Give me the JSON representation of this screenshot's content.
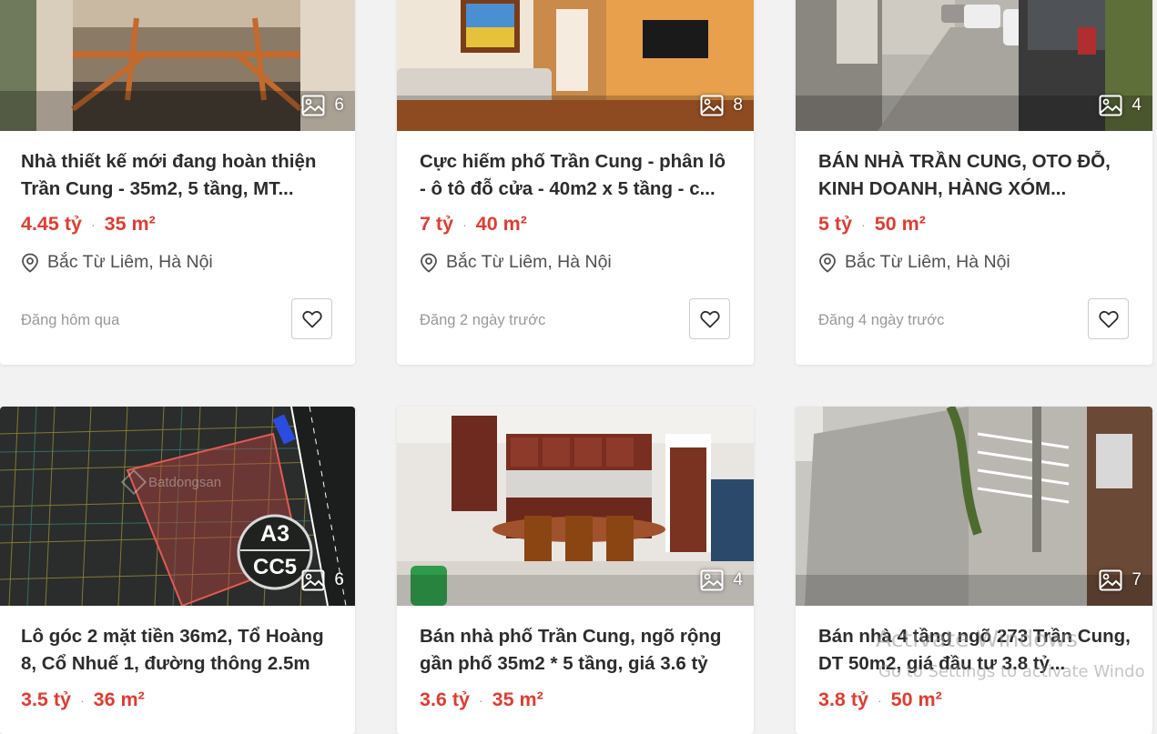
{
  "listings": [
    {
      "title": "Nhà thiết kế mới đang hoàn thiện Trần Cung - 35m2, 5 tầng, MT...",
      "price": "4.45 tỷ",
      "area": "35 m²",
      "location": "Bắc Từ Liêm, Hà Nội",
      "posted": "Đăng hôm qua",
      "photo_count": "6"
    },
    {
      "title": "Cực hiếm phố Trần Cung - phân lô - ô tô đỗ cửa - 40m2 x 5 tầng - c...",
      "price": "7 tỷ",
      "area": "40 m²",
      "location": "Bắc Từ Liêm, Hà Nội",
      "posted": "Đăng 2 ngày trước",
      "photo_count": "8"
    },
    {
      "title": "BÁN NHÀ TRẦN CUNG, OTO ĐỖ, KINH DOANH, HÀNG XÓM...",
      "price": "5 tỷ",
      "area": "50 m²",
      "location": "Bắc Từ Liêm, Hà Nội",
      "posted": "Đăng 4 ngày trước",
      "photo_count": "4"
    },
    {
      "title": "Lô góc 2 mặt tiền 36m2, Tổ Hoàng 8, Cổ Nhuế 1, đường thông 2.5m",
      "price": "3.5 tỷ",
      "area": "36 m²",
      "photo_count": "6",
      "map_label_top": "A3",
      "map_label_bottom": "CC5",
      "map_brand": "Batdongsan"
    },
    {
      "title": "Bán nhà phố Trần Cung, ngõ rộng gần phố 35m2 * 5 tầng, giá 3.6 tỷ",
      "price": "3.6 tỷ",
      "area": "35 m²",
      "photo_count": "4"
    },
    {
      "title": "Bán nhà 4 tầng ngõ 273 Trần Cung, DT 50m2, giá đầu tư 3.8 tỷ...",
      "price": "3.8 tỷ",
      "area": "50 m²",
      "photo_count": "7"
    }
  ],
  "icons": {
    "photo": "image-icon",
    "location": "map-pin-icon",
    "favorite": "heart-outline-icon"
  },
  "colors": {
    "price": "#e03c31",
    "page_bg": "#f2f2f2"
  },
  "os_watermark": {
    "line1": "Activate Windows",
    "line2": "Go to Settings to activate Windo"
  }
}
